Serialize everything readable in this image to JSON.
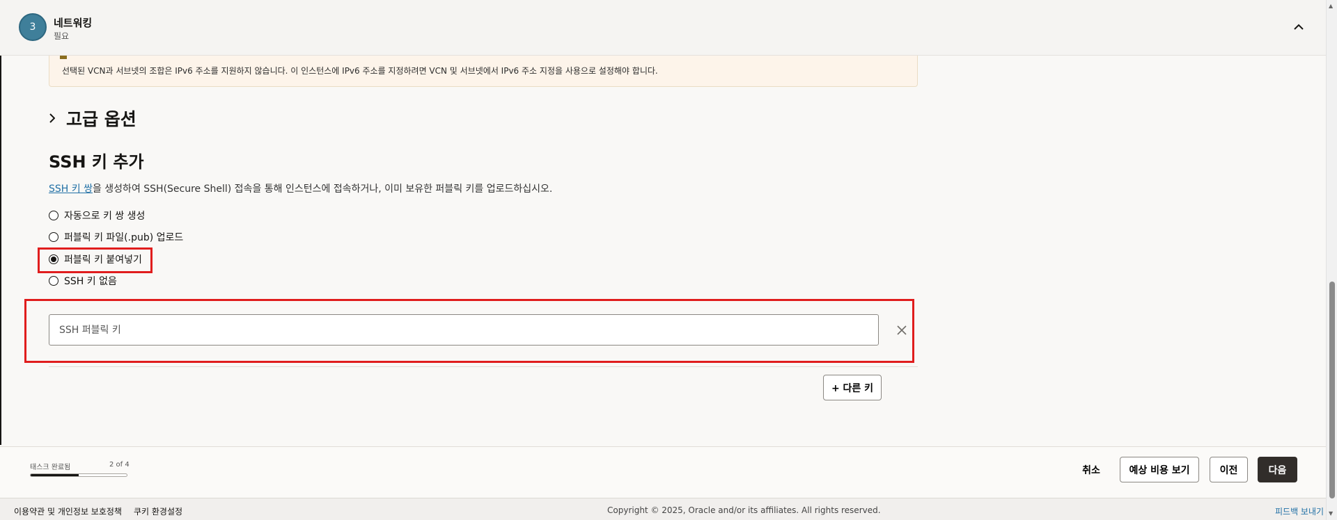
{
  "step": {
    "number": "3",
    "title": "네트워킹",
    "status": "필요"
  },
  "notice": {
    "text": "선택된 VCN과 서브넷의 조합은 IPv6 주소를 지원하지 않습니다. 이 인스턴스에 IPv6 주소를 지정하려면 VCN 및 서브넷에서 IPv6 주소 지정을 사용으로 설정해야 합니다."
  },
  "advanced": {
    "title": "고급 옵션"
  },
  "ssh": {
    "title": "SSH 키 추가",
    "desc_link": "SSH 키 쌍",
    "desc_rest": "을 생성하여 SSH(Secure Shell) 접속을 통해 인스턴스에 접속하거나, 이미 보유한 퍼블릭 키를 업로드하십시오.",
    "options": [
      {
        "label": "자동으로 키 쌍 생성",
        "selected": false
      },
      {
        "label": "퍼블릭 키 파일(.pub) 업로드",
        "selected": false
      },
      {
        "label": "퍼블릭 키 붙여넣기",
        "selected": true
      },
      {
        "label": "SSH 키 없음",
        "selected": false
      }
    ],
    "key_value": "",
    "key_placeholder": "SSH 퍼블릭 키",
    "add_key_label": "+ 다른 키"
  },
  "progress": {
    "label": "태스크 완료됨",
    "count": "2 of 4",
    "fraction": 0.5
  },
  "actions": {
    "cancel": "취소",
    "estimate": "예상 비용 보기",
    "previous": "이전",
    "next": "다음"
  },
  "footer": {
    "terms": "이용약관 및 개인정보 보호정책",
    "cookies": "쿠키 환경설정",
    "copyright": "Copyright © 2025, Oracle and/or its affiliates. All rights reserved.",
    "feedback": "피드백 보내기"
  },
  "colors": {
    "highlight": "#e01d1d",
    "primary_button": "#312d2a",
    "link": "#1f6fa5",
    "step_circle": "#3f7f9a"
  }
}
